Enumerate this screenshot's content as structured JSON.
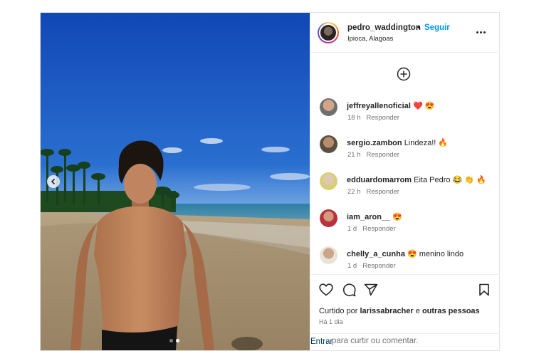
{
  "post": {
    "author": {
      "username": "pedro_waddington",
      "separator": "•",
      "follow_label": "Seguir",
      "location": "Ipioca, Alagoas"
    },
    "carousel": {
      "slides": 2,
      "active_index": 1
    },
    "comments": [
      {
        "username": "jeffreyallenoficial",
        "text": "❤️ 😍",
        "time": "18 h",
        "reply_label": "Responder"
      },
      {
        "username": "sergio.zambon",
        "text": "Lindeza!! 🔥",
        "time": "21 h",
        "reply_label": "Responder"
      },
      {
        "username": "edduardomarrom",
        "text": "Eita Pedro 😂 👏 🔥",
        "time": "22 h",
        "reply_label": "Responder"
      },
      {
        "username": "iam_aron__",
        "text": "😍",
        "time": "1 d",
        "reply_label": "Responder"
      },
      {
        "username": "chelly_a_cunha",
        "text": "😍 menino lindo",
        "time": "1 d",
        "reply_label": "Responder"
      }
    ],
    "liked_by": {
      "prefix": "Curtido por",
      "user": "larissabracher",
      "conj": "e",
      "others": "outras pessoas"
    },
    "posted": "Há 1 dia",
    "comment_box": {
      "login_link": "Entrar",
      "placeholder": "para curtir ou comentar."
    }
  },
  "icons": {
    "add_comment": "plus-circle-icon",
    "like": "heart-icon",
    "comment": "speech-bubble-icon",
    "share": "paper-plane-icon",
    "save": "bookmark-icon",
    "more": "ellipsis-icon",
    "prev": "chevron-left-icon"
  }
}
